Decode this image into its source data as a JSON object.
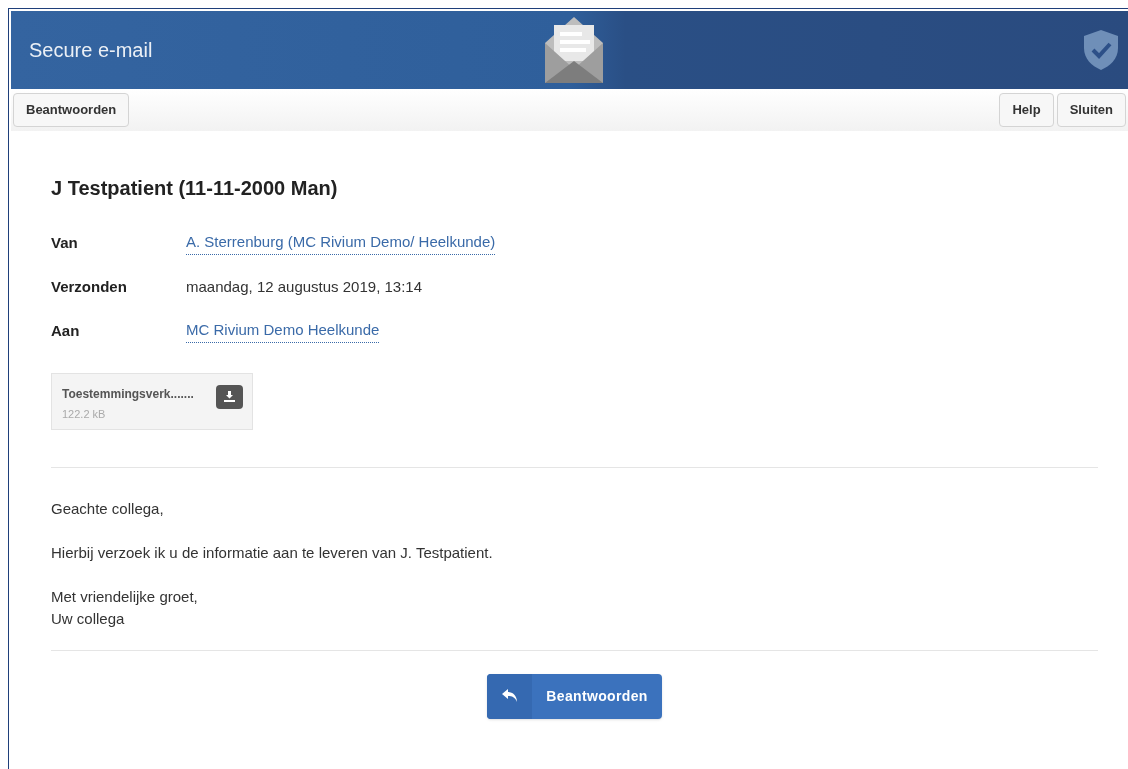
{
  "header": {
    "title": "Secure e-mail"
  },
  "toolbar": {
    "left": [
      "Beantwoorden"
    ],
    "right": [
      "Help",
      "Sluiten"
    ]
  },
  "message": {
    "title": "J Testpatient (11-11-2000 Man)",
    "meta": [
      {
        "label": "Van",
        "value": "A. Sterrenburg (MC Rivium Demo/ Heelkunde)",
        "kind": "link"
      },
      {
        "label": "Verzonden",
        "value": "maandag, 12 augustus 2019, 13:14",
        "kind": "text"
      },
      {
        "label": "Aan",
        "value": "MC Rivium Demo Heelkunde",
        "kind": "link"
      }
    ],
    "attachment": {
      "name": "Toestemmingsverk.......",
      "size": "122.2 kB"
    },
    "body": [
      "Geachte collega,",
      "Hierbij verzoek ik u de informatie aan te leveren van J. Testpatient.",
      "Met vriendelijke groet,\nUw collega"
    ],
    "reply_button": "Beantwoorden"
  }
}
